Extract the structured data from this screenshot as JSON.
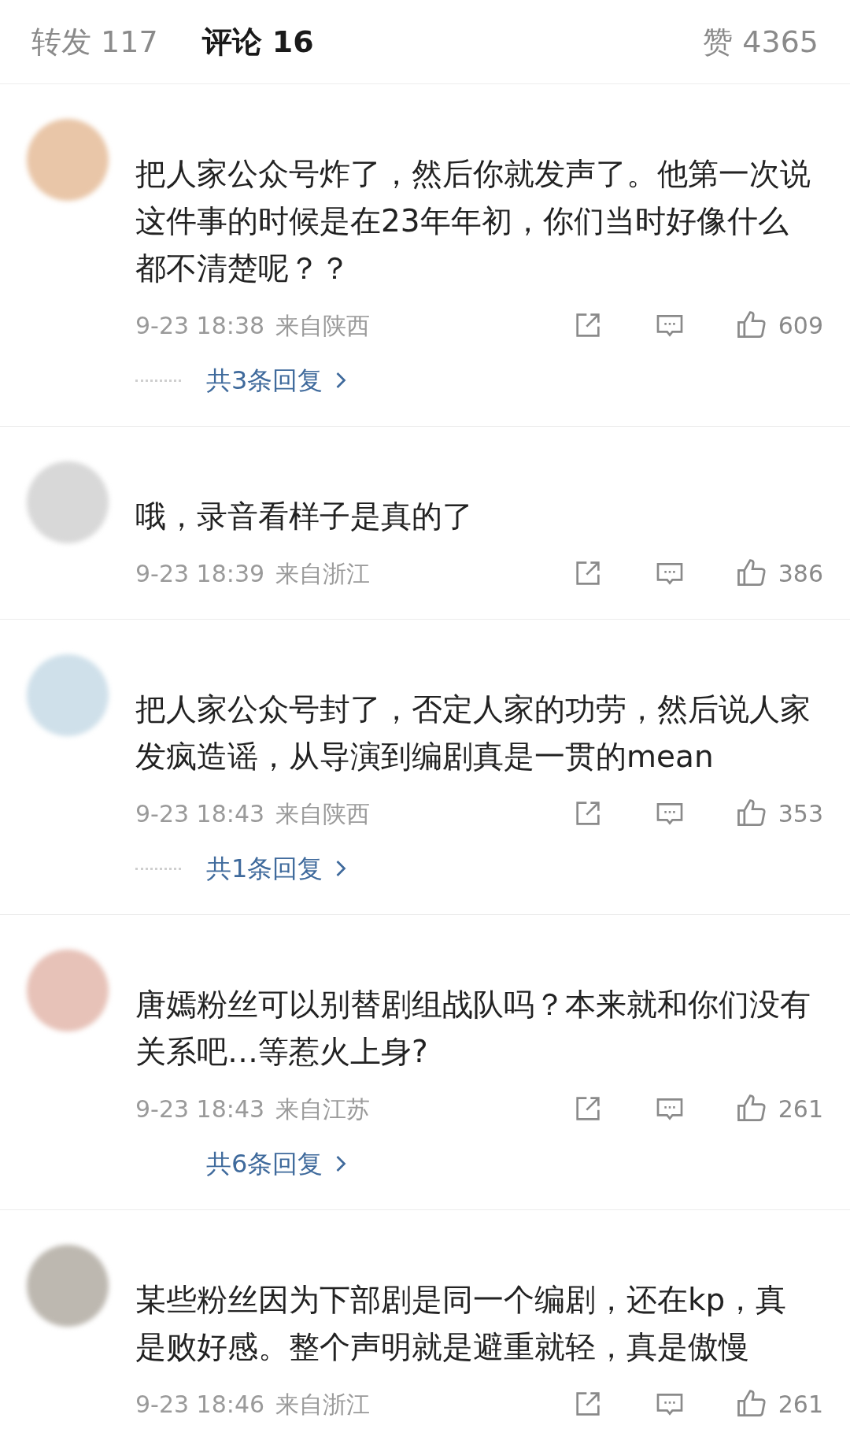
{
  "tabs": [
    {
      "label": "转发 117",
      "selected": false
    },
    {
      "label": "评论 16",
      "selected": true
    },
    {
      "label": "赞 4365",
      "selected": false
    }
  ],
  "comments": [
    {
      "text": "把人家公众号炸了，然后你就发声了。他第一次说这件事的时候是在23年年初，你们当时好像什么都不清楚呢？？",
      "time": "9-23 18:38",
      "location": "来自陕西",
      "likes": "609",
      "replies": {
        "label": "共3条回复",
        "dotted": true
      }
    },
    {
      "text": "哦，录音看样子是真的了",
      "time": "9-23 18:39",
      "location": "来自浙江",
      "likes": "386"
    },
    {
      "text": "把人家公众号封了，否定人家的功劳，然后说人家发疯造谣，从导演到编剧真是一贯的mean",
      "time": "9-23 18:43",
      "location": "来自陕西",
      "likes": "353",
      "replies": {
        "label": "共1条回复",
        "dotted": true
      }
    },
    {
      "text": "唐嫣粉丝可以别替剧组战队吗？本来就和你们没有关系吧…等惹火上身?",
      "time": "9-23 18:43",
      "location": "来自江苏",
      "likes": "261",
      "replies": {
        "label": "共6条回复",
        "dotted": false
      }
    },
    {
      "text": "某些粉丝因为下部剧是同一个编剧，还在kp，真是败好感。整个声明就是避重就轻，真是傲慢",
      "time": "9-23 18:46",
      "location": "来自浙江",
      "likes": "261"
    }
  ]
}
